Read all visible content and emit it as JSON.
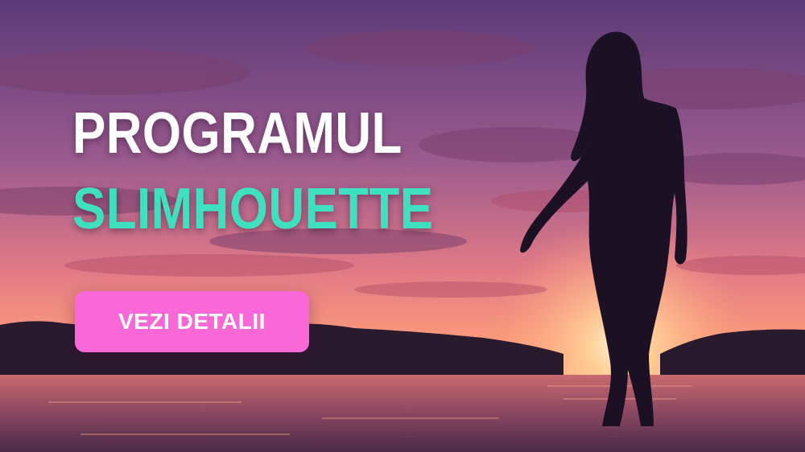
{
  "banner": {
    "title_line1": "PROGRAMUL",
    "title_line2": "SLIMHOUETTE",
    "cta_label": "VEZI DETALII"
  },
  "colors": {
    "title_primary": "#ffffff",
    "title_accent": "#3fe0bf",
    "cta_background": "#f968d6",
    "cta_text": "#ffffff",
    "sky_top": "#5b3a78",
    "horizon": "#ff9f7a",
    "silhouette": "#1c1025"
  }
}
